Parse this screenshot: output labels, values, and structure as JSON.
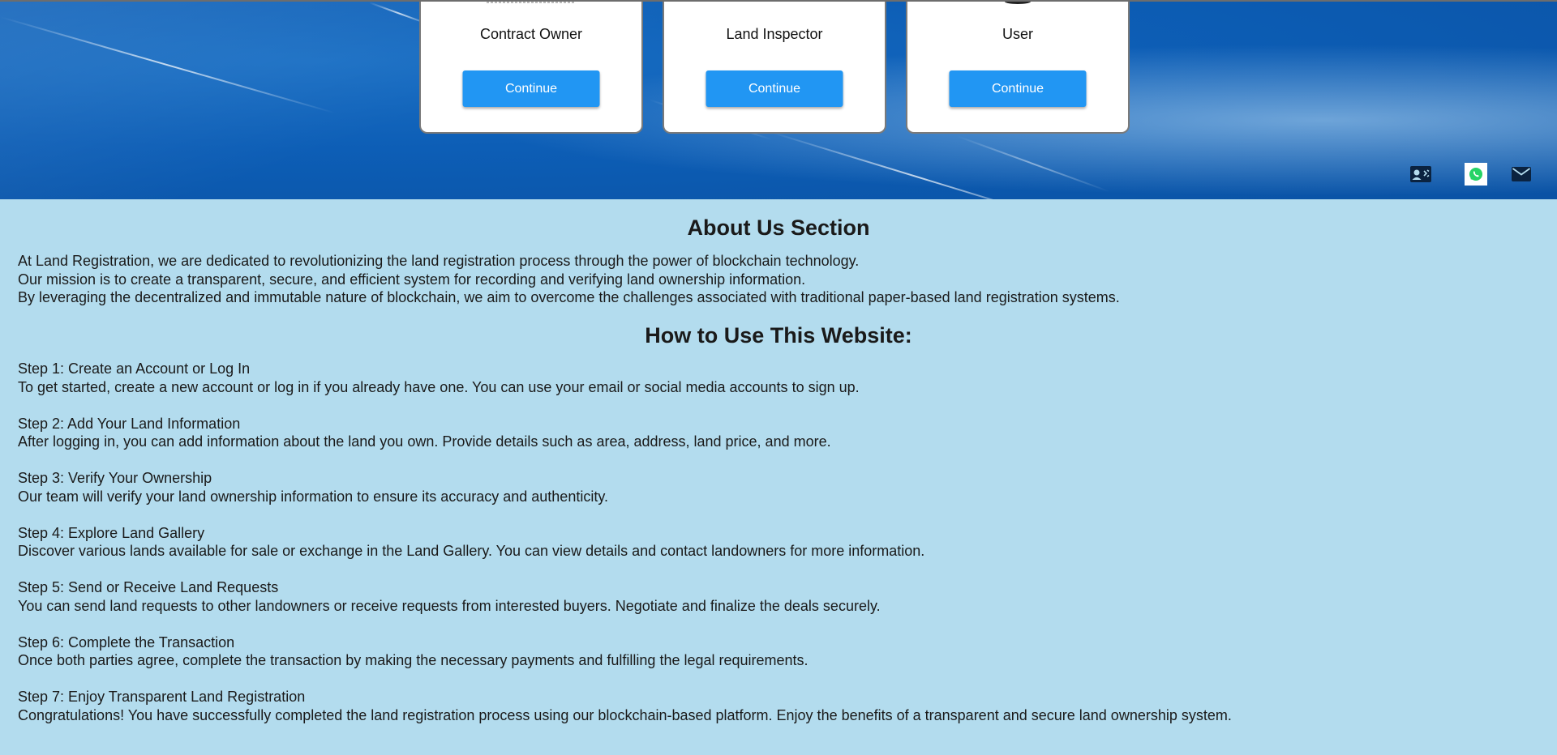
{
  "roles": [
    {
      "title": "Contract Owner",
      "button": "Continue"
    },
    {
      "title": "Land Inspector",
      "button": "Continue"
    },
    {
      "title": "User",
      "button": "Continue"
    }
  ],
  "social": [
    "contact-card-icon",
    "whatsapp-icon",
    "mail-icon"
  ],
  "about": {
    "title": "About Us Section",
    "lines": [
      "At Land Registration, we are dedicated to revolutionizing the land registration process through the power of blockchain technology.",
      "Our mission is to create a transparent, secure, and efficient system for recording and verifying land ownership information.",
      "By leveraging the decentralized and immutable nature of blockchain, we aim to overcome the challenges associated with traditional paper-based land registration systems."
    ]
  },
  "howto": {
    "title": "How to Use This Website:",
    "steps": [
      {
        "heading": "Step 1: Create an Account or Log In",
        "text": "To get started, create a new account or log in if you already have one. You can use your email or social media accounts to sign up."
      },
      {
        "heading": "Step 2: Add Your Land Information",
        "text": "After logging in, you can add information about the land you own. Provide details such as area, address, land price, and more."
      },
      {
        "heading": "Step 3: Verify Your Ownership",
        "text": "Our team will verify your land ownership information to ensure its accuracy and authenticity."
      },
      {
        "heading": "Step 4: Explore Land Gallery",
        "text": "Discover various lands available for sale or exchange in the Land Gallery. You can view details and contact landowners for more information."
      },
      {
        "heading": "Step 5: Send or Receive Land Requests",
        "text": "You can send land requests to other landowners or receive requests from interested buyers. Negotiate and finalize the deals securely."
      },
      {
        "heading": "Step 6: Complete the Transaction",
        "text": "Once both parties agree, complete the transaction by making the necessary payments and fulfilling the legal requirements."
      },
      {
        "heading": "Step 7: Enjoy Transparent Land Registration",
        "text": "Congratulations! You have successfully completed the land registration process using our blockchain-based platform. Enjoy the benefits of a transparent and secure land ownership system."
      }
    ]
  },
  "colors": {
    "button": "#2196f3",
    "section_bg": "#b3dcee",
    "hero_bg": "#0d5eb6"
  }
}
